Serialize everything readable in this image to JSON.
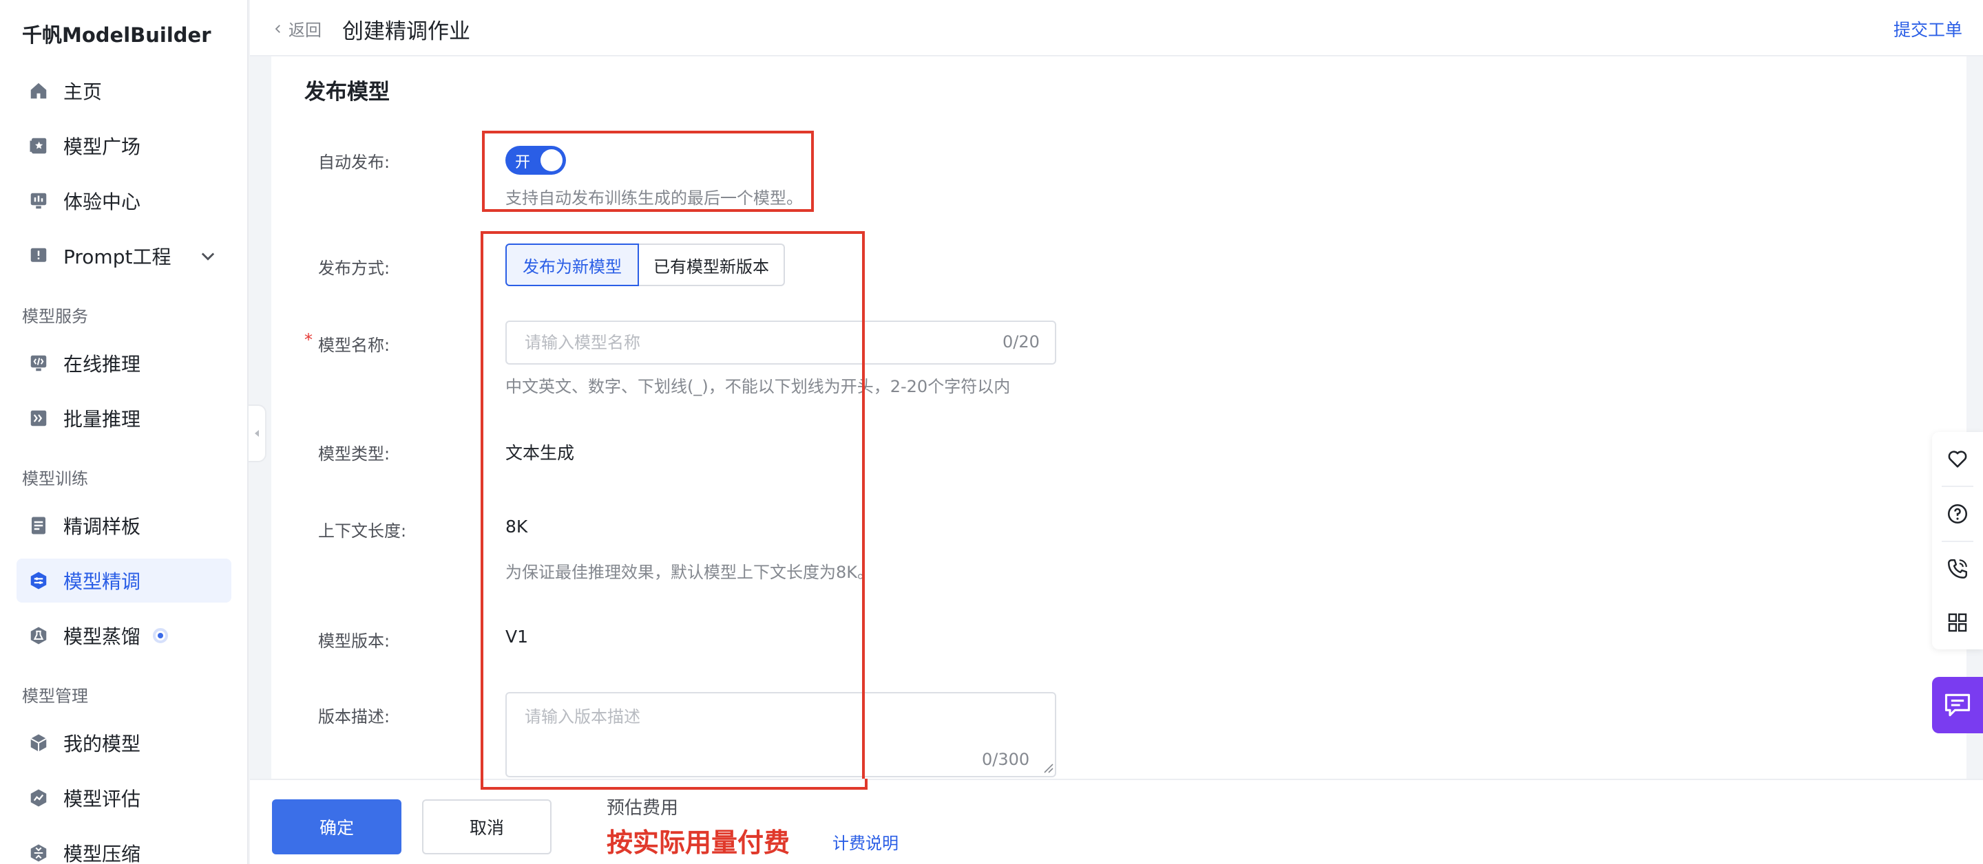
{
  "app": {
    "brand": "千帆ModelBuilder"
  },
  "sidebar": {
    "items": [
      {
        "label": "主页",
        "icon": "home-icon"
      },
      {
        "label": "模型广场",
        "icon": "model-square-icon"
      },
      {
        "label": "体验中心",
        "icon": "experience-icon"
      },
      {
        "label": "Prompt工程",
        "icon": "prompt-icon"
      }
    ],
    "sections": [
      {
        "title": "模型服务",
        "items": [
          {
            "label": "在线推理",
            "icon": "online-inference-icon"
          },
          {
            "label": "批量推理",
            "icon": "batch-inference-icon"
          }
        ]
      },
      {
        "title": "模型训练",
        "items": [
          {
            "label": "精调样板",
            "icon": "template-icon"
          },
          {
            "label": "模型精调",
            "icon": "fine-tune-icon",
            "active": true
          },
          {
            "label": "模型蒸馏",
            "icon": "distill-icon"
          }
        ]
      },
      {
        "title": "模型管理",
        "items": [
          {
            "label": "我的模型",
            "icon": "cube-icon"
          },
          {
            "label": "模型评估",
            "icon": "evaluation-icon"
          },
          {
            "label": "模型压缩",
            "icon": "compress-icon"
          }
        ]
      }
    ]
  },
  "header": {
    "back_label": "返回",
    "title": "创建精调作业",
    "ticket_link": "提交工单"
  },
  "form": {
    "section_title": "发布模型",
    "auto_publish": {
      "label": "自动发布:",
      "toggle_text": "开",
      "enabled": true,
      "help": "支持自动发布训练生成的最后一个模型。"
    },
    "publish_mode": {
      "label": "发布方式:",
      "options": [
        "发布为新模型",
        "已有模型新版本"
      ],
      "selected": "发布为新模型"
    },
    "model_name": {
      "label": "模型名称:",
      "required_mark": "*",
      "placeholder": "请输入模型名称",
      "value": "",
      "counter": "0/20",
      "help": "中文英文、数字、下划线(_)，不能以下划线为开头，2-20个字符以内"
    },
    "model_type": {
      "label": "模型类型:",
      "value": "文本生成"
    },
    "context_length": {
      "label": "上下文长度:",
      "value": "8K",
      "help": "为保证最佳推理效果，默认模型上下文长度为8K。"
    },
    "model_version": {
      "label": "模型版本:",
      "value": "V1"
    },
    "version_desc": {
      "label": "版本描述:",
      "placeholder": "请输入版本描述",
      "value": "",
      "counter": "0/300"
    }
  },
  "footer": {
    "confirm": "确定",
    "cancel": "取消",
    "fee_label": "预估费用",
    "fee_value": "按实际用量付费",
    "fee_link": "计费说明"
  },
  "float_toolbar": {
    "icons": [
      "heart-icon",
      "help-icon",
      "phone-icon",
      "grid-icon"
    ],
    "chat_icon": "chat-icon"
  },
  "colors": {
    "primary": "#2a5ee6",
    "highlight": "#e0392b",
    "chat": "#7a3cf0"
  }
}
